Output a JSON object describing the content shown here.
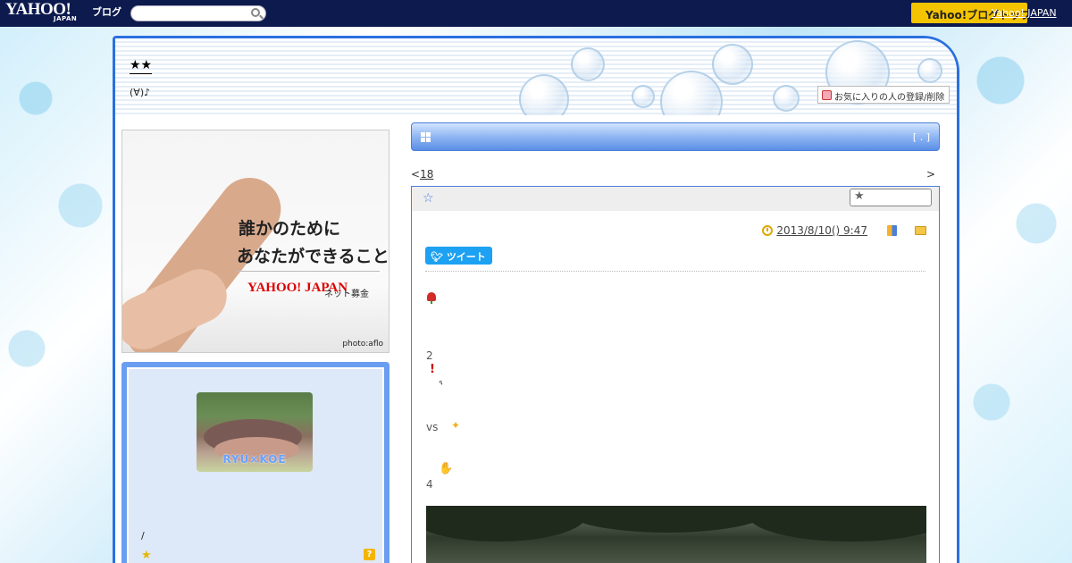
{
  "topbar": {
    "logo": "YAHOO!",
    "logo_sub": "JAPAN",
    "logo_blog": "ブログ",
    "search_placeholder": "",
    "primary_button": "Yahoo!ブログトップ",
    "link": "Yahoo! JAPAN"
  },
  "header": {
    "blog_title": "★★",
    "blog_subtitle": "(∀)♪",
    "favorite_button": "お気に入りの人の登録/削除"
  },
  "ad": {
    "line1": "誰かのために",
    "line2": "あなたができること",
    "logo": "YAHOO! JAPAN",
    "logo_tag": "ネット募金",
    "credit": "photo:aflo"
  },
  "profile": {
    "photo_label": "RYU×KOE",
    "slash_text": "/"
  },
  "section": {
    "bracket": "[ . ]"
  },
  "nav": {
    "prev_symbol": "<",
    "prev_label": "18",
    "next_symbol": ">"
  },
  "article": {
    "title": "☆",
    "date": "2013/8/10()  9:47",
    "tweet_label": "ツイート",
    "lines": [
      "2",
      "vs",
      "4"
    ]
  },
  "colors": {
    "topbar": "#0c1a4e",
    "accent_blue": "#2a6fe0",
    "button_yellow": "#f5c400",
    "twitter": "#1da1f2"
  },
  "icons": [
    "search-icon",
    "heart-icon",
    "grid-icon",
    "star-icon",
    "clock-icon",
    "book-icon",
    "folder-icon",
    "bird-icon",
    "tulip-icon",
    "exclamation-icon",
    "sparkle-icon",
    "thumbs-up-icon",
    "help-icon"
  ]
}
